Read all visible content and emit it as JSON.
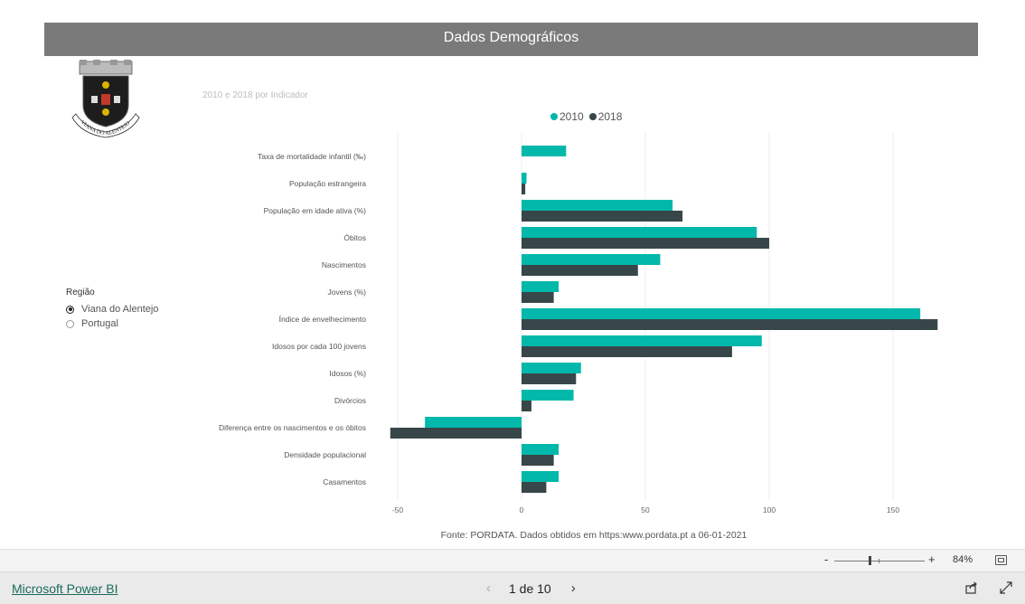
{
  "header": {
    "title": "Dados Demográficos"
  },
  "logo": {
    "text": "VIANA DO ALENTEJO"
  },
  "subtitle": "2010 e 2018 por Indicador",
  "slicer": {
    "title": "Região",
    "options": [
      {
        "label": "Viana do Alentejo",
        "selected": true
      },
      {
        "label": "Portugal",
        "selected": false
      }
    ]
  },
  "colors": {
    "series2010": "#01b8aa",
    "series2018": "#374649",
    "header_bg": "#7a7a7a",
    "link": "#1a6b5a"
  },
  "chart_data": {
    "type": "bar",
    "orientation": "horizontal",
    "title": "",
    "categories": [
      "Taxa de mortalidade infantil (‰)",
      "População estrangeira",
      "População em idade ativa (%)",
      "Óbitos",
      "Nascimentos",
      "Jovens (%)",
      "Índice de envelhecimento",
      "Idosos por cada 100 jovens",
      "Idosos (%)",
      "Divórcios",
      "Diferença entre os nascimentos e os óbitos",
      "Densidade populacional",
      "Casamentos"
    ],
    "series": [
      {
        "name": "2010",
        "values": [
          18,
          2,
          61,
          95,
          56,
          15,
          161,
          97,
          24,
          21,
          -39,
          15,
          15
        ]
      },
      {
        "name": "2018",
        "values": [
          0,
          1.5,
          65,
          100,
          47,
          13,
          168,
          85,
          22,
          4,
          -53,
          13,
          10
        ]
      }
    ],
    "xlim": [
      -55,
      170
    ],
    "xticks": [
      "-50",
      "0",
      "50",
      "100",
      "150"
    ],
    "grid": true,
    "legend": "top-center"
  },
  "source": "Fonte: PORDATA. Dados obtidos em https:www.pordata.pt a 06-01-2021",
  "zoom": {
    "minus": "-",
    "plus": "+",
    "value": "84%",
    "level": 84
  },
  "footer": {
    "brand": "Microsoft Power BI",
    "page": "1 de 10",
    "prev": "‹",
    "next": "›"
  }
}
